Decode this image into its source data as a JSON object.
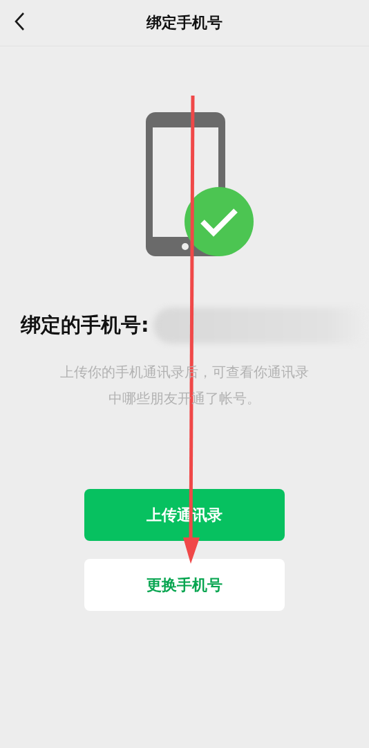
{
  "header": {
    "title": "绑定手机号"
  },
  "bound": {
    "label": "绑定的手机号:"
  },
  "description": "上传你的手机通讯录后，可查看你通讯录中哪些朋友开通了帐号。",
  "buttons": [
    {
      "label": "上传通讯录",
      "kind": "primary"
    },
    {
      "label": "更换手机号",
      "kind": "secondary"
    }
  ]
}
